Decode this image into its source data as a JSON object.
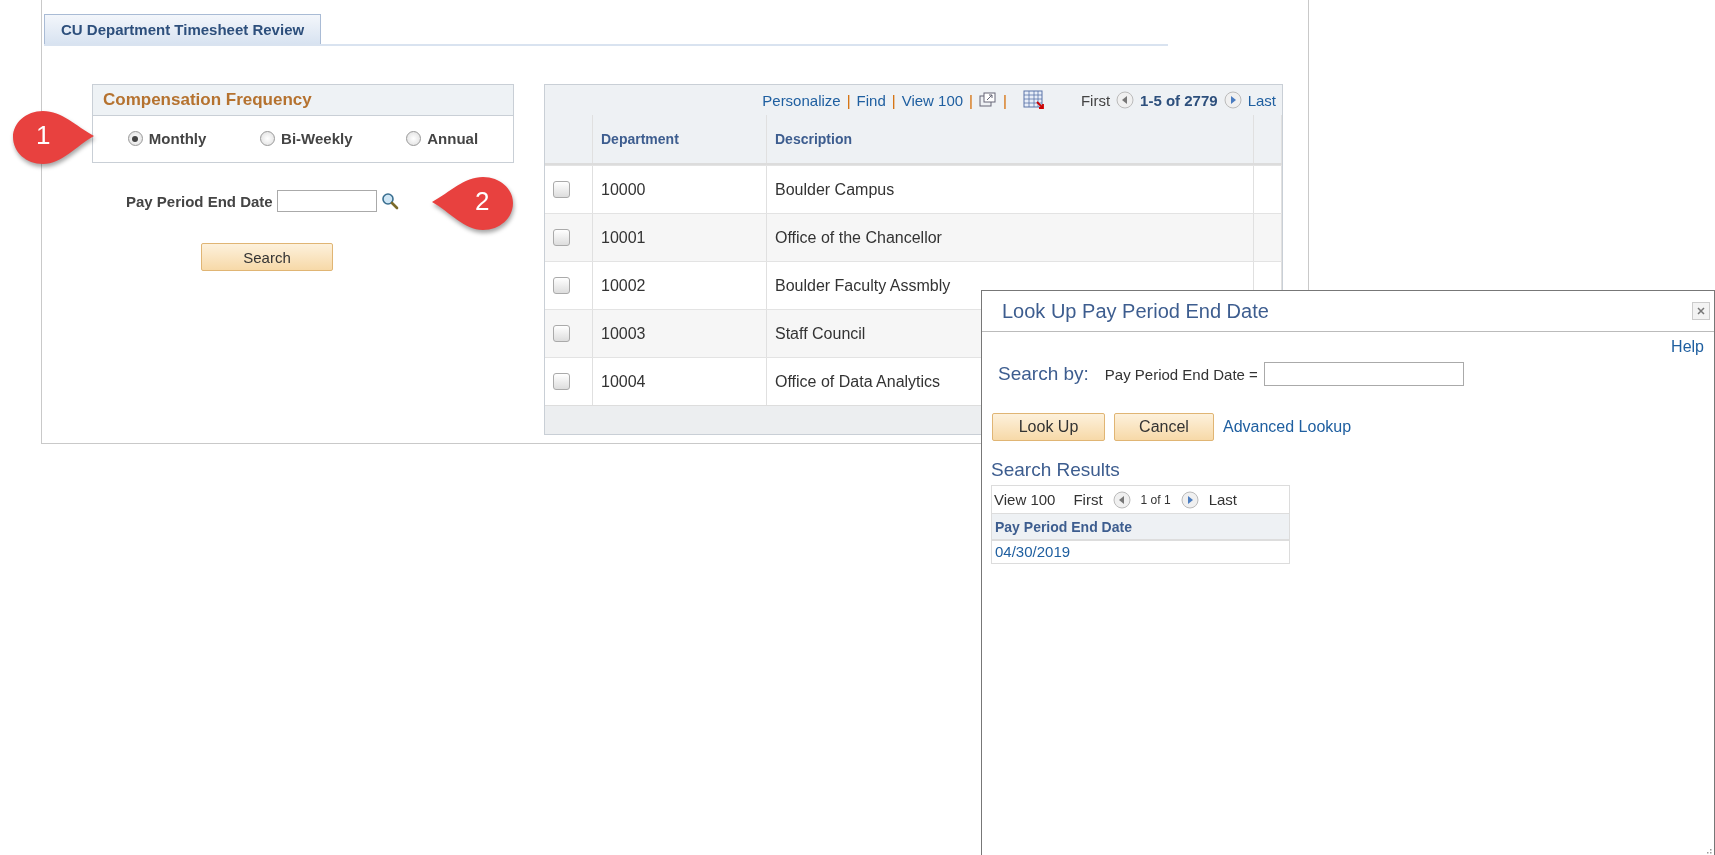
{
  "page_tab": {
    "label": "CU Department Timesheet Review",
    "selected": true
  },
  "compensation_frequency": {
    "title": "Compensation Frequency",
    "options": [
      {
        "label": "Monthly",
        "selected": true
      },
      {
        "label": "Bi-Weekly",
        "selected": false
      },
      {
        "label": "Annual",
        "selected": false
      }
    ]
  },
  "pay_period_field": {
    "label": "Pay Period End Date"
  },
  "search_button": "Search",
  "grid": {
    "toolbar": [
      {
        "kind": "link",
        "label": "Personalize"
      },
      {
        "kind": "separator",
        "label": "|"
      },
      {
        "kind": "link",
        "label": "Find"
      },
      {
        "kind": "separator",
        "label": "|"
      },
      {
        "kind": "link",
        "label": "View 100"
      },
      {
        "kind": "separator",
        "label": "|"
      },
      {
        "kind": "zoom"
      },
      {
        "kind": "separator",
        "label": "|"
      },
      {
        "kind": "download"
      }
    ],
    "first": "First",
    "range": "1-5 of 2779",
    "last": "Last",
    "columns": [
      "Department",
      "Description"
    ],
    "rows": [
      {
        "department": "10000",
        "description": "Boulder Campus",
        "checked": false
      },
      {
        "department": "10001",
        "description": "Office of the Chancellor",
        "checked": false
      },
      {
        "department": "10002",
        "description": "Boulder Faculty Assmbly",
        "checked": false
      },
      {
        "department": "10003",
        "description": "Staff Council",
        "checked": false
      },
      {
        "department": "10004",
        "description": "Office of Data Analytics",
        "checked": false
      }
    ]
  },
  "callouts": [
    "1",
    "2"
  ],
  "lookup_dialog": {
    "title": "Look Up Pay Period End Date",
    "help": "Help",
    "search_by": "Search by:",
    "field_label": "Pay Period End Date =",
    "buttons": [
      "Look Up",
      "Cancel"
    ],
    "advanced_link": "Advanced Lookup",
    "results_title": "Search Results",
    "results_nav": {
      "view": "View 100",
      "first": "First",
      "range": "1 of 1",
      "last": "Last"
    },
    "results_column": "Pay Period End Date",
    "results_rows": [
      "04/30/2019"
    ]
  }
}
